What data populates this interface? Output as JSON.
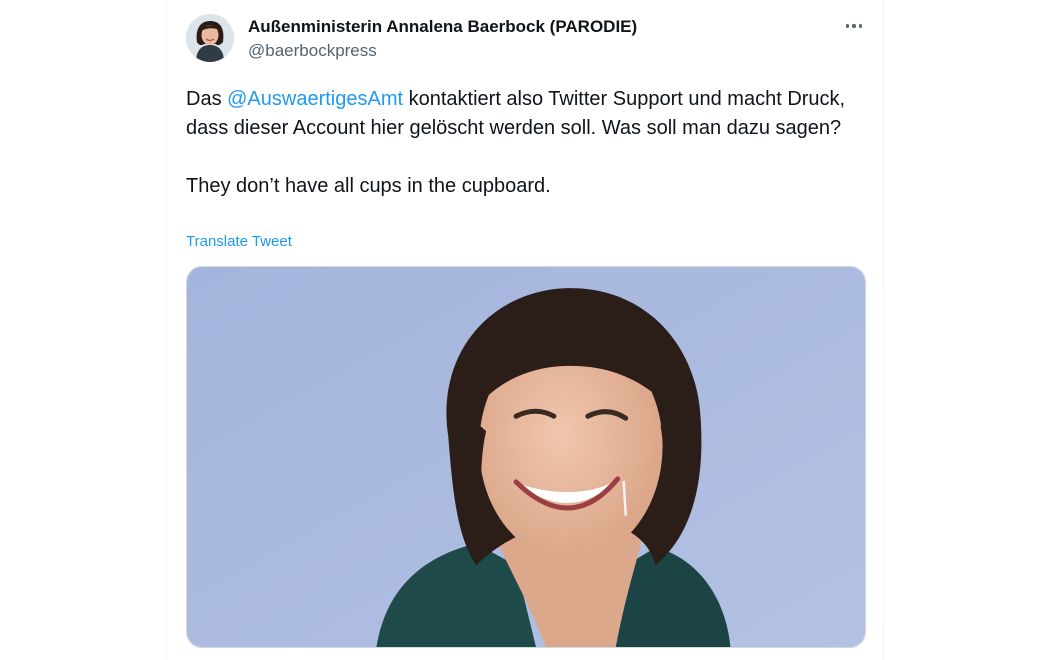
{
  "tweet": {
    "author": {
      "display_name": "Außenministerin Annalena Baerbock (PARODIE)",
      "handle": "@baerbockpress",
      "avatar_icon": "profile-photo"
    },
    "more_icon": "more-horizontal-icon",
    "text": {
      "paragraph1_prefix": "Das ",
      "mention": "@AuswaertigesAmt",
      "paragraph1_rest": " kontaktiert also Twitter Support und macht Druck, dass dieser Account hier gelöscht werden soll. Was soll man dazu sagen?",
      "paragraph2": "They don’t have all cups in the cupboard."
    },
    "translate_label": "Translate Tweet",
    "media": {
      "type": "photo"
    }
  },
  "colors": {
    "text": "#0f1419",
    "secondary": "#536471",
    "link": "#1d9bf0",
    "photo_background": "#a9b8dc"
  }
}
